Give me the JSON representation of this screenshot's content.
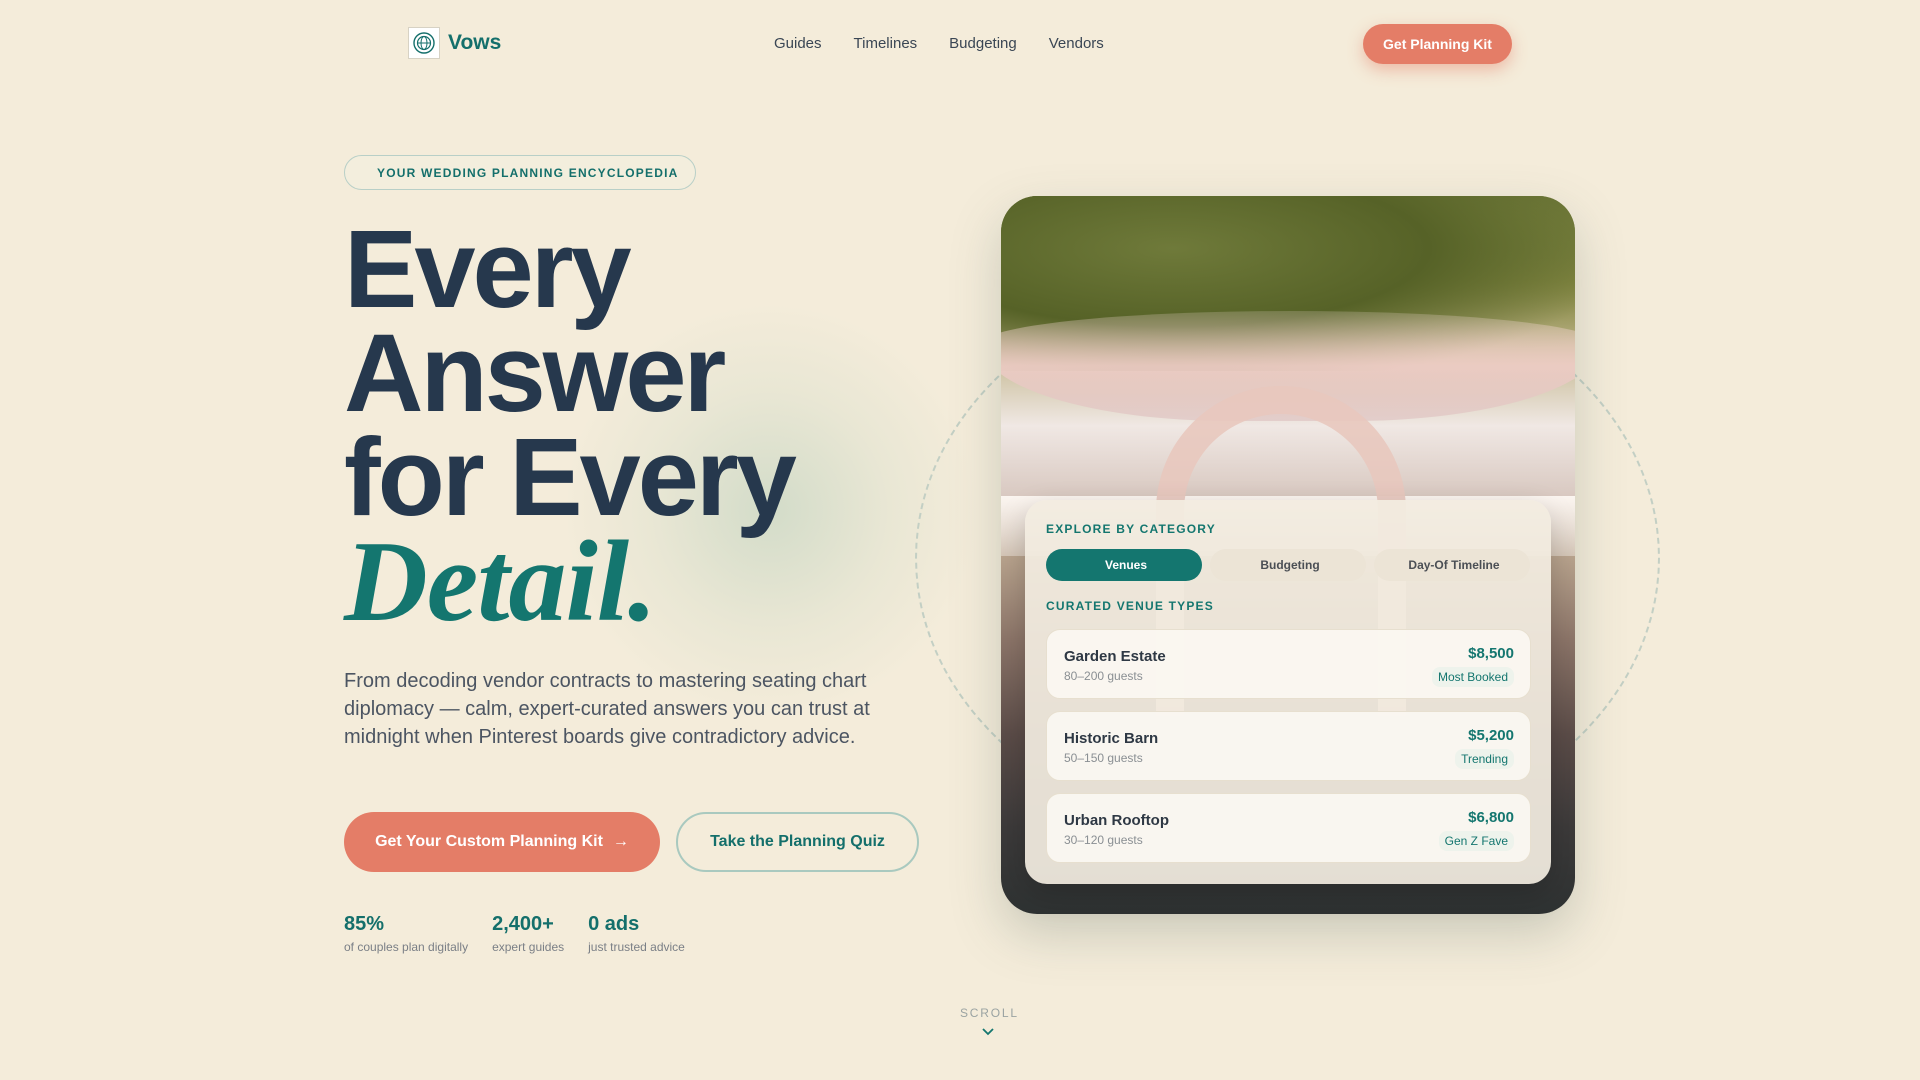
{
  "brand": {
    "name": "Vows",
    "logo_icon": "globe-seal-icon"
  },
  "nav": {
    "links": [
      "Guides",
      "Timelines",
      "Budgeting",
      "Vendors"
    ],
    "cta": "Get Planning Kit"
  },
  "hero": {
    "badge": "YOUR WEDDING PLANNING ENCYCLOPEDIA",
    "headline": {
      "line1": "Every",
      "line2": "Answer",
      "line3": "for Every",
      "accent": "Detail."
    },
    "lede": "From decoding vendor contracts to mastering seating chart diplomacy — calm, expert-curated answers you can trust at midnight when Pinterest boards give contradictory advice.",
    "primary_cta": "Get Your Custom Planning Kit",
    "primary_cta_arrow": "→",
    "secondary_cta": "Take the Planning Quiz",
    "stats": [
      {
        "value": "85%",
        "label": "of couples plan digitally"
      },
      {
        "value": "2,400+",
        "label": "expert guides"
      },
      {
        "value": "0 ads",
        "label": "just trusted advice"
      }
    ]
  },
  "explorer": {
    "eyebrow": "EXPLORE BY CATEGORY",
    "tabs": [
      {
        "label": "Venues",
        "icon": "",
        "active": true
      },
      {
        "label": "Budgeting",
        "icon": "",
        "active": false
      },
      {
        "label": "Day-Of Timeline",
        "icon": "",
        "active": false
      }
    ],
    "subheading": "CURATED VENUE TYPES",
    "venues": [
      {
        "name": "Garden Estate",
        "guests": "80–200 guests",
        "price": "$8,500",
        "tag": "Most Booked"
      },
      {
        "name": "Historic Barn",
        "guests": "50–150 guests",
        "price": "$5,200",
        "tag": "Trending"
      },
      {
        "name": "Urban Rooftop",
        "guests": "30–120 guests",
        "price": "$6,800",
        "tag": "Gen Z Fave"
      }
    ]
  },
  "scroll": {
    "label": "SCROLL",
    "icon": "chevron-down-icon"
  },
  "colors": {
    "accent": "#14766f",
    "cta": "#e47d67",
    "background": "#f4ecda",
    "heading": "#26384d"
  }
}
